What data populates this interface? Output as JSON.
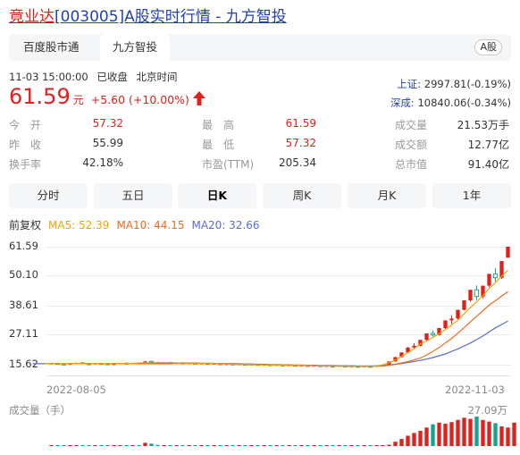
{
  "title": {
    "name_part": "竟业达",
    "rest": "[003005]A股实时行情 - 九方智投"
  },
  "tabs": [
    {
      "label": "百度股市通",
      "active": false
    },
    {
      "label": "九方智投",
      "active": true
    }
  ],
  "market_badge": "A股",
  "status": {
    "datetime": "11-03 15:00:00",
    "state": "已收盘",
    "timezone": "北京时间"
  },
  "quote": {
    "price": "61.59",
    "unit": "元",
    "change": "+5.60 (+10.00%)",
    "direction": "up"
  },
  "indices": [
    {
      "label": "上证:",
      "value": "2997.81(-0.19%)"
    },
    {
      "label": "深成:",
      "value": "10840.06(-0.34%)"
    }
  ],
  "stats": [
    {
      "k": "今　开",
      "v": "57.32",
      "color": "red"
    },
    {
      "k": "最　高",
      "v": "61.59",
      "color": "red"
    },
    {
      "k": "成交量",
      "v": "21.53万手",
      "color": "dark"
    },
    {
      "k": "昨　收",
      "v": "55.99",
      "color": "dark"
    },
    {
      "k": "最　低",
      "v": "57.32",
      "color": "red"
    },
    {
      "k": "成交额",
      "v": "12.77亿",
      "color": "dark"
    },
    {
      "k": "换手率",
      "v": "42.18%",
      "color": "dark"
    },
    {
      "k": "市盈(TTM)",
      "v": "205.34",
      "color": "dark"
    },
    {
      "k": "总市值",
      "v": "91.40亿",
      "color": "dark"
    }
  ],
  "periods": [
    {
      "label": "分时",
      "active": false
    },
    {
      "label": "五日",
      "active": false
    },
    {
      "label": "日K",
      "active": true
    },
    {
      "label": "周K",
      "active": false
    },
    {
      "label": "月K",
      "active": false
    },
    {
      "label": "1年",
      "active": false
    }
  ],
  "ma_legend": {
    "adjust": "前复权",
    "ma5": "MA5: 52.39",
    "ma10": "MA10: 44.15",
    "ma20": "MA20: 32.66"
  },
  "colors": {
    "up": "#e0201c",
    "down": "#17a589",
    "ma5": "#f4a300",
    "ma10": "#f06a1e",
    "ma20": "#5b6bd8",
    "link": "#2440b3"
  },
  "chart_data": {
    "type": "candlestick",
    "y_ticks": [
      "61.59",
      "50.10",
      "38.61",
      "27.11",
      "15.62"
    ],
    "ylim": [
      15.62,
      61.59
    ],
    "x_labels": [
      "2022-08-05",
      "2022-11-03"
    ],
    "candles": [
      {
        "o": 15.9,
        "h": 16.3,
        "l": 15.6,
        "c": 16.1
      },
      {
        "o": 16.1,
        "h": 16.4,
        "l": 15.7,
        "c": 15.9
      },
      {
        "o": 15.9,
        "h": 16.2,
        "l": 15.5,
        "c": 15.8
      },
      {
        "o": 15.8,
        "h": 16.1,
        "l": 15.5,
        "c": 16.0
      },
      {
        "o": 16.0,
        "h": 16.5,
        "l": 15.8,
        "c": 16.3
      },
      {
        "o": 16.3,
        "h": 16.6,
        "l": 15.9,
        "c": 16.0
      },
      {
        "o": 16.0,
        "h": 16.3,
        "l": 15.7,
        "c": 15.9
      },
      {
        "o": 15.9,
        "h": 16.2,
        "l": 15.6,
        "c": 16.1
      },
      {
        "o": 16.1,
        "h": 16.4,
        "l": 15.8,
        "c": 16.0
      },
      {
        "o": 16.0,
        "h": 16.2,
        "l": 15.6,
        "c": 15.8
      },
      {
        "o": 15.8,
        "h": 16.1,
        "l": 15.5,
        "c": 15.9
      },
      {
        "o": 15.9,
        "h": 16.3,
        "l": 15.7,
        "c": 16.2
      },
      {
        "o": 16.2,
        "h": 16.5,
        "l": 15.9,
        "c": 16.0
      },
      {
        "o": 16.0,
        "h": 16.4,
        "l": 15.8,
        "c": 16.3
      },
      {
        "o": 16.3,
        "h": 16.5,
        "l": 15.9,
        "c": 16.1
      },
      {
        "o": 16.1,
        "h": 17.0,
        "l": 16.0,
        "c": 16.9
      },
      {
        "o": 16.9,
        "h": 17.1,
        "l": 16.3,
        "c": 16.5
      },
      {
        "o": 16.5,
        "h": 16.8,
        "l": 16.1,
        "c": 16.3
      },
      {
        "o": 16.3,
        "h": 16.6,
        "l": 16.0,
        "c": 16.5
      },
      {
        "o": 16.5,
        "h": 16.8,
        "l": 16.1,
        "c": 16.2
      },
      {
        "o": 16.2,
        "h": 16.5,
        "l": 15.9,
        "c": 16.3
      },
      {
        "o": 16.3,
        "h": 16.6,
        "l": 16.0,
        "c": 16.1
      },
      {
        "o": 16.1,
        "h": 16.4,
        "l": 15.8,
        "c": 16.2
      },
      {
        "o": 16.2,
        "h": 16.4,
        "l": 15.9,
        "c": 16.0
      },
      {
        "o": 16.0,
        "h": 16.3,
        "l": 15.7,
        "c": 16.1
      },
      {
        "o": 16.1,
        "h": 16.3,
        "l": 15.8,
        "c": 15.9
      },
      {
        "o": 15.9,
        "h": 16.2,
        "l": 15.6,
        "c": 16.0
      },
      {
        "o": 16.0,
        "h": 16.2,
        "l": 15.7,
        "c": 15.8
      },
      {
        "o": 15.8,
        "h": 16.1,
        "l": 15.5,
        "c": 15.9
      },
      {
        "o": 15.9,
        "h": 16.1,
        "l": 15.6,
        "c": 15.7
      },
      {
        "o": 15.7,
        "h": 16.0,
        "l": 15.4,
        "c": 15.8
      },
      {
        "o": 15.8,
        "h": 16.0,
        "l": 15.5,
        "c": 15.6
      },
      {
        "o": 15.6,
        "h": 15.9,
        "l": 15.3,
        "c": 15.7
      },
      {
        "o": 15.7,
        "h": 15.9,
        "l": 15.4,
        "c": 15.5
      },
      {
        "o": 15.5,
        "h": 15.8,
        "l": 15.2,
        "c": 15.6
      },
      {
        "o": 15.6,
        "h": 15.8,
        "l": 15.3,
        "c": 15.4
      },
      {
        "o": 15.4,
        "h": 15.7,
        "l": 15.1,
        "c": 15.5
      },
      {
        "o": 15.5,
        "h": 15.7,
        "l": 15.2,
        "c": 15.3
      },
      {
        "o": 15.3,
        "h": 15.6,
        "l": 15.0,
        "c": 15.4
      },
      {
        "o": 15.4,
        "h": 15.6,
        "l": 15.1,
        "c": 15.2
      },
      {
        "o": 15.2,
        "h": 15.5,
        "l": 15.0,
        "c": 15.3
      },
      {
        "o": 15.3,
        "h": 15.5,
        "l": 15.0,
        "c": 15.1
      },
      {
        "o": 15.1,
        "h": 15.4,
        "l": 14.9,
        "c": 15.2
      },
      {
        "o": 15.2,
        "h": 15.4,
        "l": 14.9,
        "c": 15.0
      },
      {
        "o": 15.0,
        "h": 15.3,
        "l": 14.8,
        "c": 15.1
      },
      {
        "o": 15.1,
        "h": 15.3,
        "l": 14.9,
        "c": 15.0
      },
      {
        "o": 15.0,
        "h": 15.2,
        "l": 14.8,
        "c": 15.1
      },
      {
        "o": 15.1,
        "h": 15.3,
        "l": 14.9,
        "c": 14.9
      },
      {
        "o": 14.9,
        "h": 15.2,
        "l": 14.7,
        "c": 15.0
      },
      {
        "o": 15.0,
        "h": 15.2,
        "l": 14.8,
        "c": 14.9
      },
      {
        "o": 14.9,
        "h": 15.1,
        "l": 14.7,
        "c": 15.0
      },
      {
        "o": 15.0,
        "h": 15.2,
        "l": 14.8,
        "c": 14.9
      },
      {
        "o": 14.9,
        "h": 15.3,
        "l": 14.8,
        "c": 15.2
      },
      {
        "o": 15.2,
        "h": 15.6,
        "l": 15.0,
        "c": 15.5
      },
      {
        "o": 15.5,
        "h": 16.9,
        "l": 15.4,
        "c": 16.9
      },
      {
        "o": 16.9,
        "h": 18.6,
        "l": 16.8,
        "c": 18.6
      },
      {
        "o": 18.6,
        "h": 20.4,
        "l": 18.3,
        "c": 20.4
      },
      {
        "o": 20.4,
        "h": 22.5,
        "l": 20.1,
        "c": 22.3
      },
      {
        "o": 22.3,
        "h": 24.0,
        "l": 21.6,
        "c": 23.0
      },
      {
        "o": 23.0,
        "h": 25.3,
        "l": 22.7,
        "c": 25.3
      },
      {
        "o": 25.3,
        "h": 27.8,
        "l": 25.0,
        "c": 27.8
      },
      {
        "o": 27.8,
        "h": 28.9,
        "l": 26.5,
        "c": 27.2
      },
      {
        "o": 27.2,
        "h": 29.9,
        "l": 27.0,
        "c": 29.9
      },
      {
        "o": 29.9,
        "h": 32.9,
        "l": 29.5,
        "c": 32.9
      },
      {
        "o": 32.9,
        "h": 34.8,
        "l": 31.5,
        "c": 33.6
      },
      {
        "o": 33.6,
        "h": 37.0,
        "l": 33.3,
        "c": 37.0
      },
      {
        "o": 37.0,
        "h": 40.7,
        "l": 36.8,
        "c": 40.7
      },
      {
        "o": 40.7,
        "h": 44.8,
        "l": 40.2,
        "c": 44.8
      },
      {
        "o": 44.8,
        "h": 46.5,
        "l": 40.8,
        "c": 42.2
      },
      {
        "o": 42.2,
        "h": 46.4,
        "l": 41.5,
        "c": 46.4
      },
      {
        "o": 46.4,
        "h": 51.0,
        "l": 45.8,
        "c": 51.0
      },
      {
        "o": 51.0,
        "h": 53.2,
        "l": 48.0,
        "c": 49.5
      },
      {
        "o": 49.5,
        "h": 56.0,
        "l": 49.0,
        "c": 55.99
      },
      {
        "o": 57.32,
        "h": 61.59,
        "l": 57.32,
        "c": 61.59
      }
    ],
    "ma5": [
      16.0,
      16.0,
      16.0,
      16.0,
      16.0,
      16.0,
      16.0,
      16.0,
      16.0,
      16.0,
      16.0,
      16.0,
      16.0,
      16.1,
      16.1,
      16.3,
      16.4,
      16.4,
      16.5,
      16.5,
      16.4,
      16.3,
      16.2,
      16.2,
      16.1,
      16.1,
      16.0,
      16.0,
      15.9,
      15.9,
      15.8,
      15.7,
      15.7,
      15.6,
      15.6,
      15.5,
      15.5,
      15.4,
      15.4,
      15.3,
      15.3,
      15.3,
      15.2,
      15.2,
      15.1,
      15.1,
      15.1,
      15.0,
      15.0,
      15.0,
      15.0,
      15.0,
      15.0,
      15.1,
      15.6,
      16.4,
      17.5,
      18.9,
      20.3,
      21.9,
      23.7,
      24.9,
      26.2,
      27.7,
      29.3,
      31.0,
      33.0,
      35.5,
      37.9,
      40.1,
      42.6,
      45.2,
      47.6,
      50.1,
      52.39
    ],
    "ma10": [
      16.0,
      16.0,
      16.0,
      16.0,
      16.0,
      16.0,
      16.0,
      16.0,
      16.0,
      16.0,
      16.0,
      16.0,
      16.0,
      16.0,
      16.0,
      16.1,
      16.1,
      16.2,
      16.2,
      16.2,
      16.3,
      16.3,
      16.3,
      16.3,
      16.3,
      16.2,
      16.2,
      16.1,
      16.1,
      16.0,
      16.0,
      15.9,
      15.8,
      15.8,
      15.7,
      15.7,
      15.6,
      15.6,
      15.5,
      15.5,
      15.4,
      15.4,
      15.3,
      15.3,
      15.2,
      15.2,
      15.2,
      15.1,
      15.1,
      15.1,
      15.0,
      15.0,
      15.0,
      15.0,
      15.1,
      15.4,
      15.8,
      16.3,
      16.8,
      17.5,
      18.2,
      19.4,
      20.8,
      22.3,
      24.1,
      25.9,
      27.9,
      30.1,
      32.3,
      34.5,
      36.7,
      38.8,
      40.6,
      42.4,
      44.15
    ],
    "ma20": [
      16.0,
      16.0,
      16.0,
      16.0,
      16.0,
      16.0,
      16.0,
      16.0,
      16.0,
      16.0,
      16.0,
      16.0,
      16.0,
      16.0,
      16.0,
      16.0,
      16.0,
      16.0,
      16.0,
      16.0,
      16.0,
      16.0,
      16.0,
      16.1,
      16.1,
      16.1,
      16.1,
      16.1,
      16.1,
      16.1,
      16.1,
      16.0,
      16.0,
      16.0,
      15.9,
      15.9,
      15.8,
      15.8,
      15.7,
      15.7,
      15.6,
      15.6,
      15.5,
      15.5,
      15.4,
      15.4,
      15.3,
      15.3,
      15.3,
      15.2,
      15.2,
      15.2,
      15.1,
      15.1,
      15.1,
      15.2,
      15.4,
      15.6,
      15.8,
      16.1,
      16.5,
      16.9,
      17.3,
      17.8,
      18.4,
      19.1,
      19.8,
      20.8,
      21.8,
      22.9,
      24.1,
      25.4,
      26.8,
      28.4,
      30.0,
      31.3,
      32.66
    ],
    "volume": {
      "title": "成交量（手）",
      "max_label": "27.09万",
      "max": 27.09,
      "values": [
        0.4,
        0.3,
        0.3,
        0.4,
        0.5,
        0.4,
        0.3,
        0.4,
        0.3,
        0.3,
        0.3,
        0.4,
        0.3,
        0.4,
        0.3,
        3.0,
        2.2,
        1.0,
        0.8,
        0.7,
        0.6,
        0.7,
        0.5,
        0.6,
        0.5,
        0.5,
        0.4,
        0.4,
        0.4,
        0.3,
        0.4,
        0.3,
        0.3,
        0.3,
        0.3,
        0.3,
        0.3,
        0.3,
        0.3,
        0.3,
        0.3,
        0.3,
        0.3,
        0.3,
        0.3,
        0.3,
        0.3,
        0.3,
        0.3,
        0.3,
        0.3,
        0.3,
        0.4,
        0.6,
        1.2,
        4.0,
        6.5,
        9.5,
        12.0,
        14.0,
        17.0,
        20.0,
        21.5,
        20.5,
        22.0,
        24.0,
        26.0,
        25.0,
        27.09,
        24.0,
        22.5,
        21.0,
        18.0,
        17.0,
        21.53
      ]
    }
  }
}
